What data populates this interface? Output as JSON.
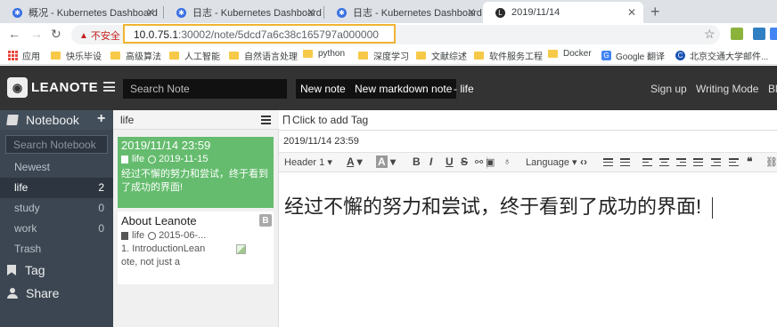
{
  "browser": {
    "tabs": [
      {
        "label": "概况 - Kubernetes Dashboard",
        "icon": "kubernetes-icon",
        "active": false
      },
      {
        "label": "日志 - Kubernetes Dashboard",
        "icon": "kubernetes-icon",
        "active": false
      },
      {
        "label": "日志 - Kubernetes Dashboard",
        "icon": "kubernetes-icon",
        "active": false
      },
      {
        "label": "2019/11/14",
        "icon": "leanote-icon",
        "active": true
      }
    ],
    "security_label": "不安全",
    "url_host": "10.0.75.1",
    "url_rest": ":30002/note/5dcd7a6c38c165797a000000",
    "bookmarks": [
      "应用",
      "快乐毕设",
      "高级算法",
      "人工智能",
      "自然语言处理",
      "python",
      "深度学习",
      "文献综述",
      "软件服务工程",
      "Docker",
      "Google 翻译",
      "北京交通大学邮件..."
    ]
  },
  "header": {
    "logo_text": "LEANOTE",
    "search_placeholder": "Search Note",
    "new_note": "New note",
    "new_markdown_note": "New markdown note",
    "current_notebook": "- life",
    "links": [
      "Sign up",
      "Writing Mode",
      "Bl"
    ]
  },
  "sidebar": {
    "notebook_title": "Notebook",
    "search_placeholder": "Search Notebook",
    "items": [
      {
        "label": "Newest",
        "count": ""
      },
      {
        "label": "life",
        "count": "2"
      },
      {
        "label": "study",
        "count": "0"
      },
      {
        "label": "work",
        "count": "0"
      },
      {
        "label": "Trash",
        "count": ""
      }
    ],
    "active_index": 1,
    "tag_label": "Tag",
    "share_label": "Share"
  },
  "note_list": {
    "title": "life",
    "notes": [
      {
        "title": "2019/11/14 23:59",
        "notebook": "life",
        "date": "2019-11-15",
        "desc": "经过不懈的努力和尝试，终于看到了成功的界面!"
      },
      {
        "title": "About Leanote",
        "notebook": "life",
        "date": "2015-06-...",
        "desc": "1. IntroductionLeanote, not just a",
        "badge": "B"
      }
    ]
  },
  "editor": {
    "tag_placeholder": "Click to add Tag",
    "title": "2019/11/14 23:59",
    "toolbar": {
      "header": "Header 1",
      "language": "Language"
    },
    "content": "经过不懈的努力和尝试，终于看到了成功的界面!"
  },
  "colors": {
    "header_bg": "#333333",
    "sidebar_bg": "#3b4652",
    "selected_note": "#65bc6e",
    "address_highlight": "#f0b432"
  }
}
